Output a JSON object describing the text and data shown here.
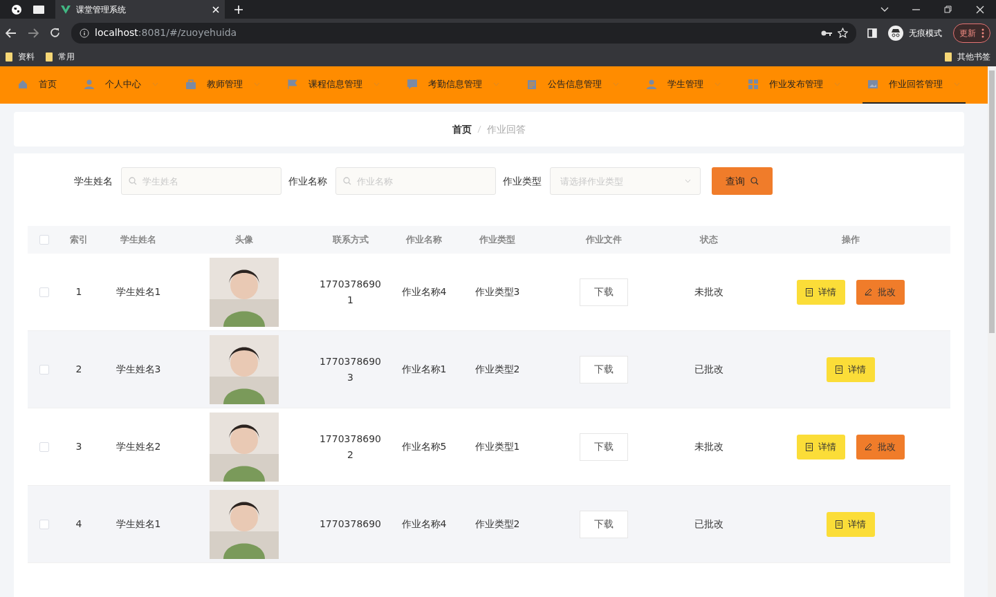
{
  "browser": {
    "tab_title": "课堂管理系统",
    "url_host": "localhost",
    "url_path": ":8081/#/zuoyehuida",
    "profile": "无痕模式",
    "update": "更新",
    "bookmarks": [
      "资料",
      "常用"
    ],
    "other_bookmarks": "其他书签"
  },
  "nav": [
    {
      "label": "首页",
      "dropdown": false,
      "selected": false
    },
    {
      "label": "个人中心",
      "dropdown": true,
      "selected": false
    },
    {
      "label": "教师管理",
      "dropdown": true,
      "selected": false
    },
    {
      "label": "课程信息管理",
      "dropdown": true,
      "selected": false
    },
    {
      "label": "考勤信息管理",
      "dropdown": true,
      "selected": false
    },
    {
      "label": "公告信息管理",
      "dropdown": true,
      "selected": false
    },
    {
      "label": "学生管理",
      "dropdown": true,
      "selected": false
    },
    {
      "label": "作业发布管理",
      "dropdown": true,
      "selected": false
    },
    {
      "label": "作业回答管理",
      "dropdown": true,
      "selected": true
    }
  ],
  "breadcrumb": [
    "首页",
    "作业回答"
  ],
  "search": {
    "fields": [
      {
        "label": "学生姓名",
        "placeholder": "学生姓名",
        "kind": "input"
      },
      {
        "label": "作业名称",
        "placeholder": "作业名称",
        "kind": "input"
      },
      {
        "label": "作业类型",
        "placeholder": "请选择作业类型",
        "kind": "select"
      }
    ],
    "button": "查询"
  },
  "table": {
    "header_checked": false,
    "columns": [
      "索引",
      "学生姓名",
      "头像",
      "联系方式",
      "作业名称",
      "作业类型",
      "作业文件",
      "状态",
      "操作"
    ],
    "rows": [
      {
        "checked": false,
        "index": "1",
        "name": "学生姓名1",
        "avatar": {
          "kind": "picture"
        },
        "phone": [
          "1770378690",
          "1"
        ],
        "hw_name": "作业名称4",
        "hw_type": "作业类型3",
        "file": "下载",
        "status": "未批改",
        "actions": [
          {
            "kind": "detail",
            "label": "详情"
          },
          {
            "kind": "review",
            "label": "批改"
          }
        ]
      },
      {
        "checked": false,
        "index": "2",
        "name": "学生姓名3",
        "avatar": {
          "kind": "picture"
        },
        "phone": [
          "1770378690",
          "3"
        ],
        "hw_name": "作业名称1",
        "hw_type": "作业类型2",
        "file": "下载",
        "status": "已批改",
        "actions": [
          {
            "kind": "detail",
            "label": "详情"
          }
        ]
      },
      {
        "checked": false,
        "index": "3",
        "name": "学生姓名2",
        "avatar": {
          "kind": "picture"
        },
        "phone": [
          "1770378690",
          "2"
        ],
        "hw_name": "作业名称5",
        "hw_type": "作业类型1",
        "file": "下载",
        "status": "未批改",
        "actions": [
          {
            "kind": "detail",
            "label": "详情"
          },
          {
            "kind": "review",
            "label": "批改"
          }
        ]
      },
      {
        "checked": false,
        "index": "4",
        "name": "学生姓名1",
        "avatar": {
          "kind": "picture"
        },
        "phone": [
          "1770378690"
        ],
        "hw_name": "作业名称4",
        "hw_type": "作业类型2",
        "file": "下载",
        "status": "已批改",
        "actions": [
          {
            "kind": "detail",
            "label": "详情"
          }
        ]
      }
    ]
  }
}
